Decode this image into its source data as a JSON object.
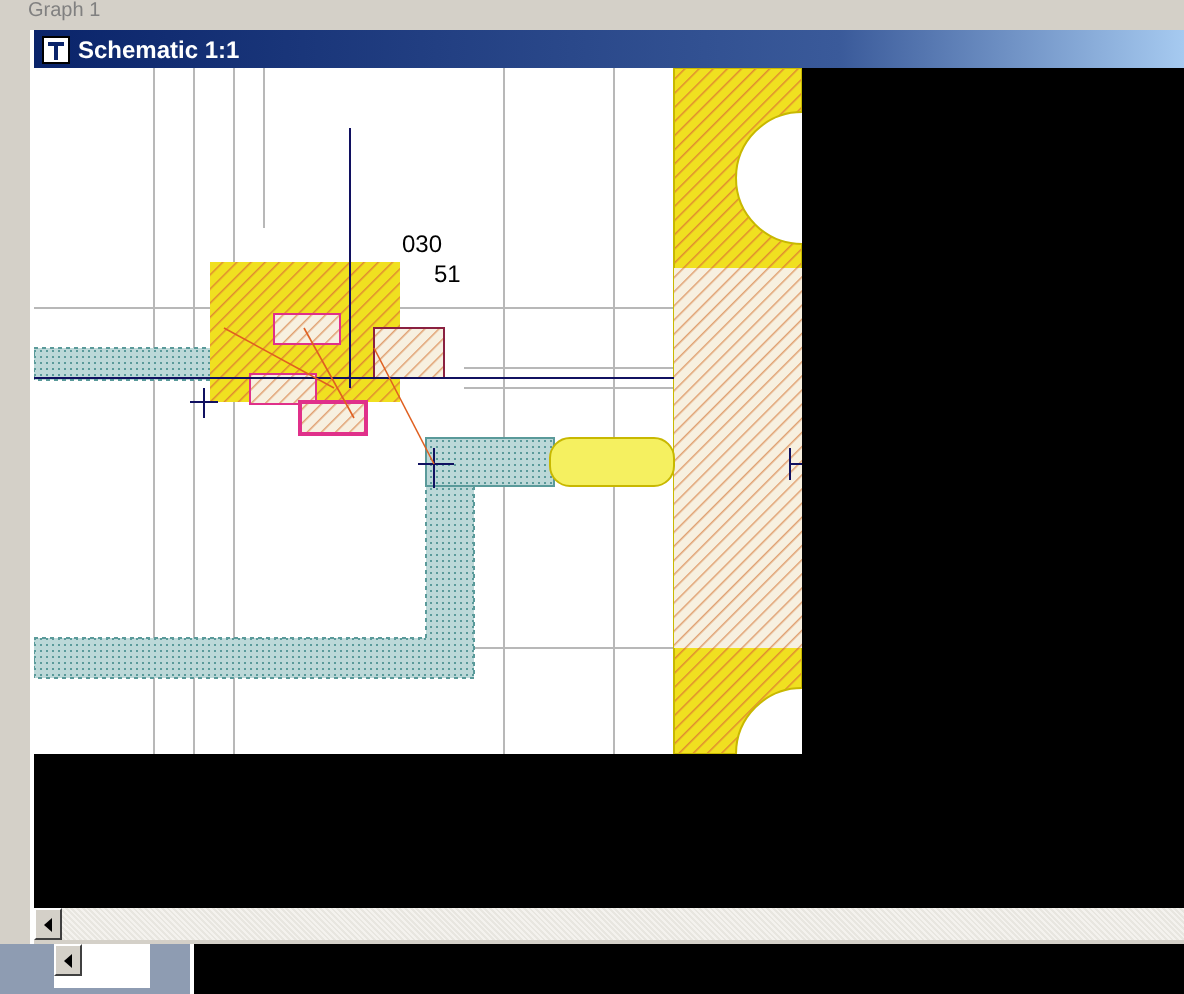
{
  "outer_window": {
    "title": "Graph 1"
  },
  "schematic_window": {
    "title": "Schematic 1:1",
    "labels": [
      {
        "text": "030"
      },
      {
        "text": "51"
      }
    ]
  }
}
